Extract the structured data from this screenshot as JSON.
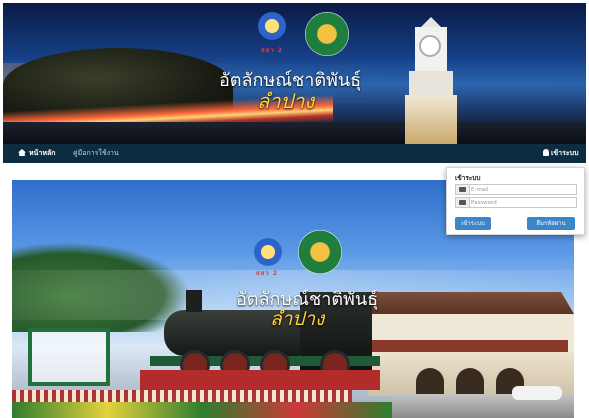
{
  "banner": {
    "tagline": "สสว 2",
    "title": "อัตลักษณ์ชาติพันธุ์",
    "subtitle": "ลำปาง"
  },
  "navbar": {
    "home_label": "หน้าหลัก",
    "manual_label": "คู่มือการใช้งาน",
    "login_label": "เข้าระบบ"
  },
  "login_panel": {
    "title": "เข้าระบบ",
    "email_placeholder": "E-mail",
    "password_placeholder": "Password",
    "login_button": "เข้าระบบ",
    "forgot_button": "ลืมรหัสผ่าน"
  },
  "hero": {
    "tagline": "สสว 2",
    "title": "อัตลักษณ์ชาติพันธุ์",
    "subtitle": "ลำปาง"
  },
  "colors": {
    "navbar": "#0b2c41",
    "button": "#3a86c8",
    "subtitle": "#ffd33a"
  },
  "icons": [
    "home-icon",
    "user-icon",
    "envelope-icon",
    "lock-icon"
  ]
}
